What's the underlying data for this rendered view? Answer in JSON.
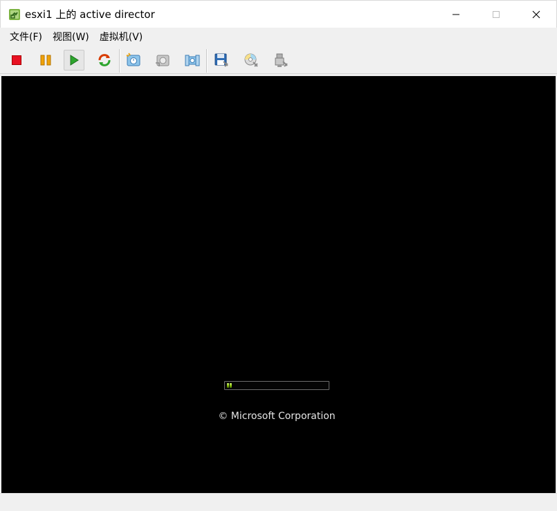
{
  "window": {
    "title": "esxi1 上的 active director",
    "app_icon": "vsphere-icon",
    "controls": [
      "minimize-icon",
      "maximize-icon",
      "close-icon"
    ]
  },
  "menu": {
    "items": [
      {
        "label": "文件(F)"
      },
      {
        "label": "视图(W)"
      },
      {
        "label": "虚拟机(V)"
      }
    ]
  },
  "toolbar": {
    "buttons": [
      {
        "icon": "power-off-icon",
        "color": "#e81123"
      },
      {
        "icon": "suspend-icon",
        "color": "#f0a30a"
      },
      {
        "icon": "power-on-icon",
        "color": "#2da52d",
        "pressed": true
      },
      {
        "icon": "reset-icon",
        "color": "#d83b01"
      },
      {
        "icon": "snapshot-icon"
      },
      {
        "icon": "revert-snapshot-icon"
      },
      {
        "icon": "snapshot-manager-icon"
      },
      {
        "icon": "floppy-icon"
      },
      {
        "icon": "cd-dvd-icon"
      },
      {
        "icon": "network-adapter-icon"
      }
    ]
  },
  "console": {
    "background": "#000000",
    "copyright": "© Microsoft Corporation",
    "progress": {
      "accent": "#8fd400"
    }
  }
}
